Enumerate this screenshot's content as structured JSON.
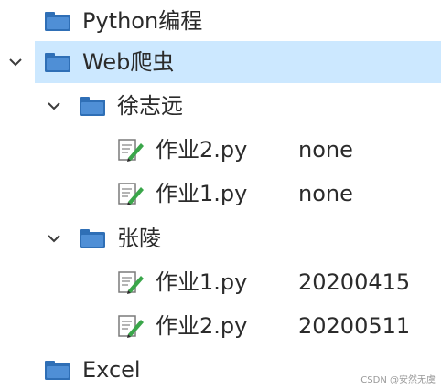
{
  "tree": {
    "items": [
      {
        "label": "Python编程",
        "type": "folder",
        "value": ""
      },
      {
        "label": "Web爬虫",
        "type": "folder",
        "value": "",
        "selected": true,
        "expanded": true
      },
      {
        "label": "徐志远",
        "type": "folder",
        "value": "",
        "expanded": true
      },
      {
        "label": "作业2.py",
        "type": "file",
        "value": "none"
      },
      {
        "label": "作业1.py",
        "type": "file",
        "value": "none"
      },
      {
        "label": "张陵",
        "type": "folder",
        "value": "",
        "expanded": true
      },
      {
        "label": "作业1.py",
        "type": "file",
        "value": "20200415"
      },
      {
        "label": "作业2.py",
        "type": "file",
        "value": "20200511"
      },
      {
        "label": "Excel",
        "type": "folder",
        "value": ""
      }
    ]
  },
  "colors": {
    "selection": "#cce8ff",
    "folder_blue": "#2f6fb6",
    "text": "#2b2b2b"
  },
  "watermark": "CSDN @安然无虞"
}
